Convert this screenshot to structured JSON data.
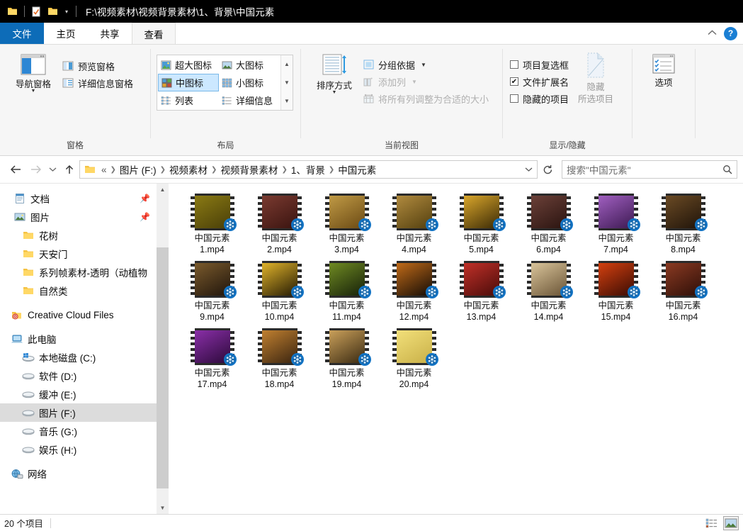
{
  "titlebar": {
    "path": "F:\\视频素材\\视频背景素材\\1、背景\\中国元素",
    "icons": [
      "folder-icon",
      "properties-icon",
      "new-folder-icon",
      "customize-chevron-icon"
    ]
  },
  "tabs": [
    {
      "label": "文件",
      "state": "file-menu"
    },
    {
      "label": "主页",
      "state": "normal"
    },
    {
      "label": "共享",
      "state": "normal"
    },
    {
      "label": "查看",
      "state": "active"
    }
  ],
  "ribbon": {
    "collapse_label": "^",
    "help_label": "?",
    "groups": [
      {
        "name": "窗格",
        "big": {
          "label": "导航窗格",
          "has_dropdown": true
        },
        "items": [
          {
            "label": "预览窗格",
            "enabled": true
          },
          {
            "label": "详细信息窗格",
            "enabled": true
          }
        ]
      },
      {
        "name": "布局",
        "gallery": [
          {
            "label": "超大图标",
            "selected": false
          },
          {
            "label": "大图标",
            "selected": false
          },
          {
            "label": "中图标",
            "selected": true
          },
          {
            "label": "小图标",
            "selected": false
          },
          {
            "label": "列表",
            "selected": false
          },
          {
            "label": "详细信息",
            "selected": false
          }
        ]
      },
      {
        "name": "当前视图",
        "big": {
          "label": "排序方式",
          "has_dropdown": true
        },
        "items": [
          {
            "label": "分组依据",
            "enabled": true,
            "has_caret": true
          },
          {
            "label": "添加列",
            "enabled": false,
            "has_caret": true
          },
          {
            "label": "将所有列调整为合适的大小",
            "enabled": false,
            "has_caret": false
          }
        ]
      },
      {
        "name": "显示/隐藏",
        "checkboxes": [
          {
            "label": "项目复选框",
            "checked": false
          },
          {
            "label": "文件扩展名",
            "checked": true
          },
          {
            "label": "隐藏的项目",
            "checked": false
          }
        ],
        "big": {
          "label_line1": "隐藏",
          "label_line2": "所选项目",
          "enabled": false
        }
      },
      {
        "name": "",
        "big": {
          "label": "选项",
          "has_dropdown": false
        }
      }
    ]
  },
  "addressbar": {
    "back_icon": "back-arrow-icon",
    "forward_icon": "forward-arrow-icon",
    "recent_icon": "recent-locations-icon",
    "up_icon": "up-arrow-icon",
    "overflow": "«",
    "crumbs": [
      "图片 (F:)",
      "视频素材",
      "视频背景素材",
      "1、背景",
      "中国元素"
    ],
    "dropdown_icon": "chevron-down-icon",
    "refresh_icon": "refresh-icon",
    "search_placeholder": "搜索\"中国元素\""
  },
  "sidebar": {
    "items": [
      {
        "label": "文档",
        "icon": "documents-icon",
        "indent": 1,
        "pinned": true,
        "selected": false
      },
      {
        "label": "图片",
        "icon": "pictures-icon",
        "indent": 1,
        "pinned": true,
        "selected": false
      },
      {
        "label": "花树",
        "icon": "folder-icon",
        "indent": 2,
        "pinned": false,
        "selected": false
      },
      {
        "label": "天安门",
        "icon": "folder-icon",
        "indent": 2,
        "pinned": false,
        "selected": false
      },
      {
        "label": "系列帧素材-透明（动植物",
        "icon": "folder-icon",
        "indent": 2,
        "pinned": false,
        "selected": false
      },
      {
        "label": "自然类",
        "icon": "folder-icon",
        "indent": 2,
        "pinned": false,
        "selected": false
      },
      {
        "label": "Creative Cloud Files",
        "icon": "creative-cloud-icon",
        "indent": 0,
        "pinned": false,
        "selected": false
      },
      {
        "label": "此电脑",
        "icon": "this-pc-icon",
        "indent": 0,
        "pinned": false,
        "selected": false
      },
      {
        "label": "本地磁盘 (C:)",
        "icon": "windows-drive-icon",
        "indent": 1,
        "pinned": false,
        "selected": false
      },
      {
        "label": "软件 (D:)",
        "icon": "drive-icon",
        "indent": 1,
        "pinned": false,
        "selected": false
      },
      {
        "label": "缓冲 (E:)",
        "icon": "drive-icon",
        "indent": 1,
        "pinned": false,
        "selected": false
      },
      {
        "label": "图片 (F:)",
        "icon": "drive-icon",
        "indent": 1,
        "pinned": false,
        "selected": true
      },
      {
        "label": "音乐 (G:)",
        "icon": "drive-icon",
        "indent": 1,
        "pinned": false,
        "selected": false
      },
      {
        "label": "娱乐 (H:)",
        "icon": "drive-icon",
        "indent": 1,
        "pinned": false,
        "selected": false
      },
      {
        "label": "网络",
        "icon": "network-icon",
        "indent": 0,
        "pinned": false,
        "selected": false
      }
    ]
  },
  "files": [
    {
      "name_line1": "中国元素",
      "name_line2": "1.mp4",
      "c1": "#8a7a14",
      "c2": "#4a3f08",
      "type": "video"
    },
    {
      "name_line1": "中国元素",
      "name_line2": "2.mp4",
      "c1": "#7a3a30",
      "c2": "#3a1410",
      "type": "video"
    },
    {
      "name_line1": "中国元素",
      "name_line2": "3.mp4",
      "c1": "#c09a45",
      "c2": "#6b4a14",
      "type": "video"
    },
    {
      "name_line1": "中国元素",
      "name_line2": "4.mp4",
      "c1": "#b08a3e",
      "c2": "#54400f",
      "type": "video"
    },
    {
      "name_line1": "中国元素",
      "name_line2": "5.mp4",
      "c1": "#d9a62b",
      "c2": "#3b2a06",
      "type": "video"
    },
    {
      "name_line1": "中国元素",
      "name_line2": "6.mp4",
      "c1": "#6b4038",
      "c2": "#2a1410",
      "type": "video"
    },
    {
      "name_line1": "中国元素",
      "name_line2": "7.mp4",
      "c1": "#a05fc0",
      "c2": "#3d1a52",
      "type": "video"
    },
    {
      "name_line1": "中国元素",
      "name_line2": "8.mp4",
      "c1": "#6a4a24",
      "c2": "#20140a",
      "type": "video"
    },
    {
      "name_line1": "中国元素",
      "name_line2": "9.mp4",
      "c1": "#7a5a2c",
      "c2": "#20150c",
      "type": "video"
    },
    {
      "name_line1": "中国元素",
      "name_line2": "10.mp4",
      "c1": "#e0b32a",
      "c2": "#241a04",
      "type": "video"
    },
    {
      "name_line1": "中国元素",
      "name_line2": "11.mp4",
      "c1": "#6f8a22",
      "c2": "#16200a",
      "type": "video"
    },
    {
      "name_line1": "中国元素",
      "name_line2": "12.mp4",
      "c1": "#c06a18",
      "c2": "#140c06",
      "type": "video"
    },
    {
      "name_line1": "中国元素",
      "name_line2": "13.mp4",
      "c1": "#c03028",
      "c2": "#4a0c0a",
      "type": "video"
    },
    {
      "name_line1": "中国元素",
      "name_line2": "14.mp4",
      "c1": "#d9c49a",
      "c2": "#6a5436",
      "type": "video"
    },
    {
      "name_line1": "中国元素",
      "name_line2": "15.mp4",
      "c1": "#d4400f",
      "c2": "#3a0c04",
      "type": "video"
    },
    {
      "name_line1": "中国元素",
      "name_line2": "16.mp4",
      "c1": "#8a3a22",
      "c2": "#2e0f08",
      "type": "video"
    },
    {
      "name_line1": "中国元素",
      "name_line2": "17.mp4",
      "c1": "#8a2fa8",
      "c2": "#2c0a3a",
      "type": "video"
    },
    {
      "name_line1": "中国元素",
      "name_line2": "18.mp4",
      "c1": "#c08030",
      "c2": "#3a2410",
      "type": "video"
    },
    {
      "name_line1": "中国元素",
      "name_line2": "19.mp4",
      "c1": "#caa05a",
      "c2": "#3a2a12",
      "type": "video"
    },
    {
      "name_line1": "中国元素",
      "name_line2": "20.mp4",
      "c1": "#f2e07a",
      "c2": "#c9b048",
      "type": "video"
    }
  ],
  "statusbar": {
    "count_text": "20 个项目",
    "view_details_icon": "details-view-icon",
    "view_thumbnails_icon": "large-icons-view-icon"
  }
}
